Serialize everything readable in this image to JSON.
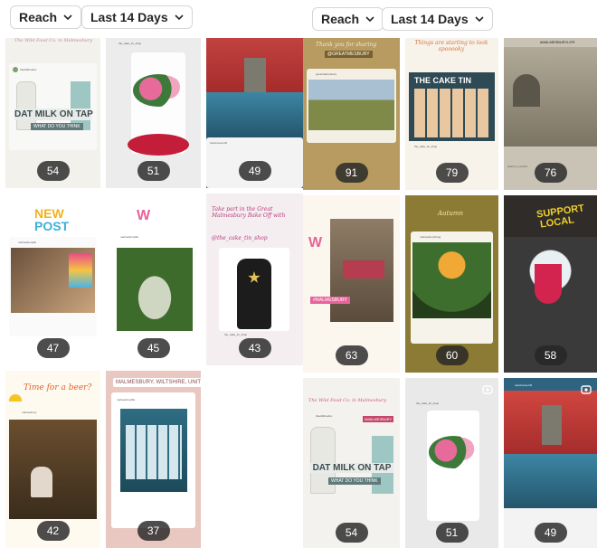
{
  "toolbar_left": {
    "metric": "Reach",
    "range": "Last 14 Days"
  },
  "toolbar_right": {
    "metric": "Reach",
    "range": "Last 14 Days"
  },
  "left_tiles": [
    {
      "reach": "54",
      "handle": "thewildfoodco",
      "text_a": "The Wild Food Co. in Malmesbury",
      "text_b": "DAT MILK ON TAP",
      "text_c": "WHAT DO YOU THINK",
      "tag": ""
    },
    {
      "reach": "51",
      "handle": "the_cake_tin_shop",
      "text_a": "",
      "text_b": "",
      "text_c": "",
      "tag": ""
    },
    {
      "reach": "49",
      "handle": "townhouse.hill",
      "text_a": "",
      "text_b": "",
      "text_c": "",
      "tag": ""
    },
    {
      "reach": "47",
      "handle": "malmesburylife",
      "text_a": "NEW",
      "text_b": "POST",
      "text_c": "",
      "tag": ""
    },
    {
      "reach": "45",
      "handle": "malmesburylife",
      "text_a": "",
      "text_b": "",
      "text_c": "",
      "tag": ""
    },
    {
      "reach": "43",
      "handle": "the_cake_tin_shop",
      "text_a": "Take part in the Great Malmesbury Bake Off with",
      "text_b": "@the_cake_tin_shop",
      "text_c": "",
      "tag": ""
    },
    {
      "reach": "42",
      "handle": "malmesbury",
      "text_a": "Time for a beer?",
      "text_b": "",
      "text_c": "",
      "tag": ""
    },
    {
      "reach": "37",
      "handle": "malmesburylife",
      "text_a": "",
      "text_b": "",
      "text_c": "",
      "tag": "MALMESBURY, WILTSHIRE, UNITED K..."
    }
  ],
  "right_tiles": [
    {
      "reach": "91",
      "handle": "greatmalmesbury",
      "text_a": "Thank you for sharing",
      "text_b": "",
      "text_c": "",
      "tag": "@GREATMESBURY"
    },
    {
      "reach": "79",
      "handle": "the_cake_tin_shop",
      "text_a": "Things are starting to look spooooky",
      "text_b": "THE CAKE TIN",
      "text_c": "",
      "tag": ""
    },
    {
      "reach": "76",
      "handle": "heard_in_london",
      "text_a": "",
      "text_b": "",
      "text_c": "",
      "tag": "#MALMESBURYLIFE"
    },
    {
      "reach": "63",
      "handle": "",
      "text_a": "",
      "text_b": "",
      "text_c": "",
      "tag": "#MALMESBURY"
    },
    {
      "reach": "60",
      "handle": "malmesburyliving",
      "text_a": "Autumn",
      "text_b": "",
      "text_c": "",
      "tag": ""
    },
    {
      "reach": "58",
      "handle": "",
      "text_a": "SUPPORT",
      "text_b": "LOCAL",
      "text_c": "",
      "tag": ""
    },
    {
      "reach": "54",
      "handle": "thewildfoodco",
      "text_a": "The Wild Food Co. in Malmesbury",
      "text_b": "DAT MILK ON TAP",
      "text_c": "WHAT DO YOU THINK",
      "tag": "#MALMESBURY"
    },
    {
      "reach": "51",
      "handle": "the_cake_tin_shop",
      "text_a": "",
      "text_b": "",
      "text_c": "",
      "tag": ""
    },
    {
      "reach": "49",
      "handle": "townhouse.hill",
      "text_a": "",
      "text_b": "",
      "text_c": "",
      "tag": ""
    }
  ],
  "colors": {
    "badge_bg": "#262626",
    "milk_bg": "#f1efe8",
    "cake_bg": "#e9e9e9",
    "autumn_red": "#c23b3b",
    "lake_blue": "#2f6f8c",
    "chalk_bg": "#f6f1ea",
    "olive_bg": "#8a7a3a",
    "pink_bg": "#e9c9c2",
    "dark_bg": "#3b3a36"
  }
}
